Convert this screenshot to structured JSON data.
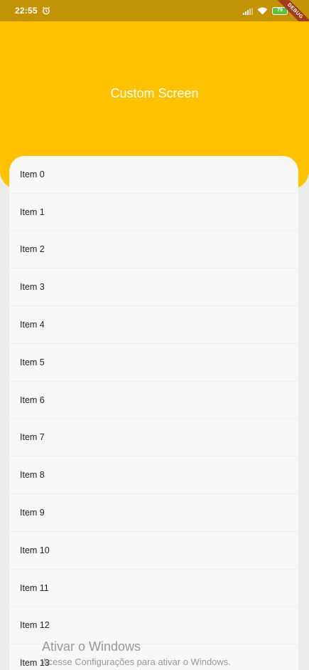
{
  "status_bar": {
    "time": "22:55",
    "battery": "79",
    "debug_label": "DEBUG",
    "icons": [
      "alarm-icon",
      "signal-icon",
      "wifi-icon",
      "battery-icon"
    ]
  },
  "header": {
    "title": "Custom Screen"
  },
  "list": {
    "items": [
      {
        "label": "Item 0"
      },
      {
        "label": "Item 1"
      },
      {
        "label": "Item 2"
      },
      {
        "label": "Item 3"
      },
      {
        "label": "Item 4"
      },
      {
        "label": "Item 5"
      },
      {
        "label": "Item 6"
      },
      {
        "label": "Item 7"
      },
      {
        "label": "Item 8"
      },
      {
        "label": "Item 9"
      },
      {
        "label": "Item 10"
      },
      {
        "label": "Item 11"
      },
      {
        "label": "Item 12"
      },
      {
        "label": "Item 13"
      }
    ]
  },
  "watermark": {
    "title": "Ativar o Windows",
    "subtitle": "Acesse Configurações para ativar o Windows."
  },
  "colors": {
    "status_bar": "#c29304",
    "header": "#ffc200",
    "list_bg": "#f7f8f6",
    "page_bg": "#ececea"
  }
}
